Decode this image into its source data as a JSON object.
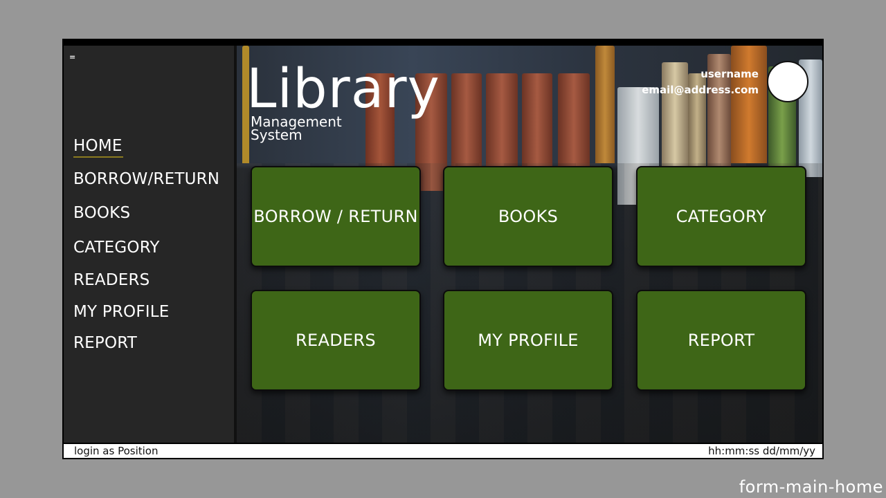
{
  "sidebar": {
    "menu_icon": "=",
    "items": [
      {
        "label": "HOME",
        "active": true
      },
      {
        "label": "BORROW/RETURN",
        "active": false
      },
      {
        "label": "BOOKS",
        "active": false
      },
      {
        "label": "CATEGORY",
        "active": false
      },
      {
        "label": "READERS",
        "active": false
      },
      {
        "label": "MY PROFILE",
        "active": false
      },
      {
        "label": "REPORT",
        "active": false
      }
    ]
  },
  "header": {
    "title": "Library",
    "subtitle_line1": "Management",
    "subtitle_line2": "System",
    "username": "username",
    "email": "email@address.com"
  },
  "tiles": [
    {
      "label": "BORROW / RETURN"
    },
    {
      "label": "BOOKS"
    },
    {
      "label": "CATEGORY"
    },
    {
      "label": "READERS"
    },
    {
      "label": "MY PROFILE"
    },
    {
      "label": "REPORT"
    }
  ],
  "status": {
    "login": "login as Position",
    "datetime": "hh:mm:ss dd/mm/yy"
  },
  "form_name": "form-main-home",
  "colors": {
    "page_bg": "#979797",
    "sidebar_bg": "#262626",
    "tile_bg": "#3e6617",
    "active_underline": "#8b7a1f"
  }
}
